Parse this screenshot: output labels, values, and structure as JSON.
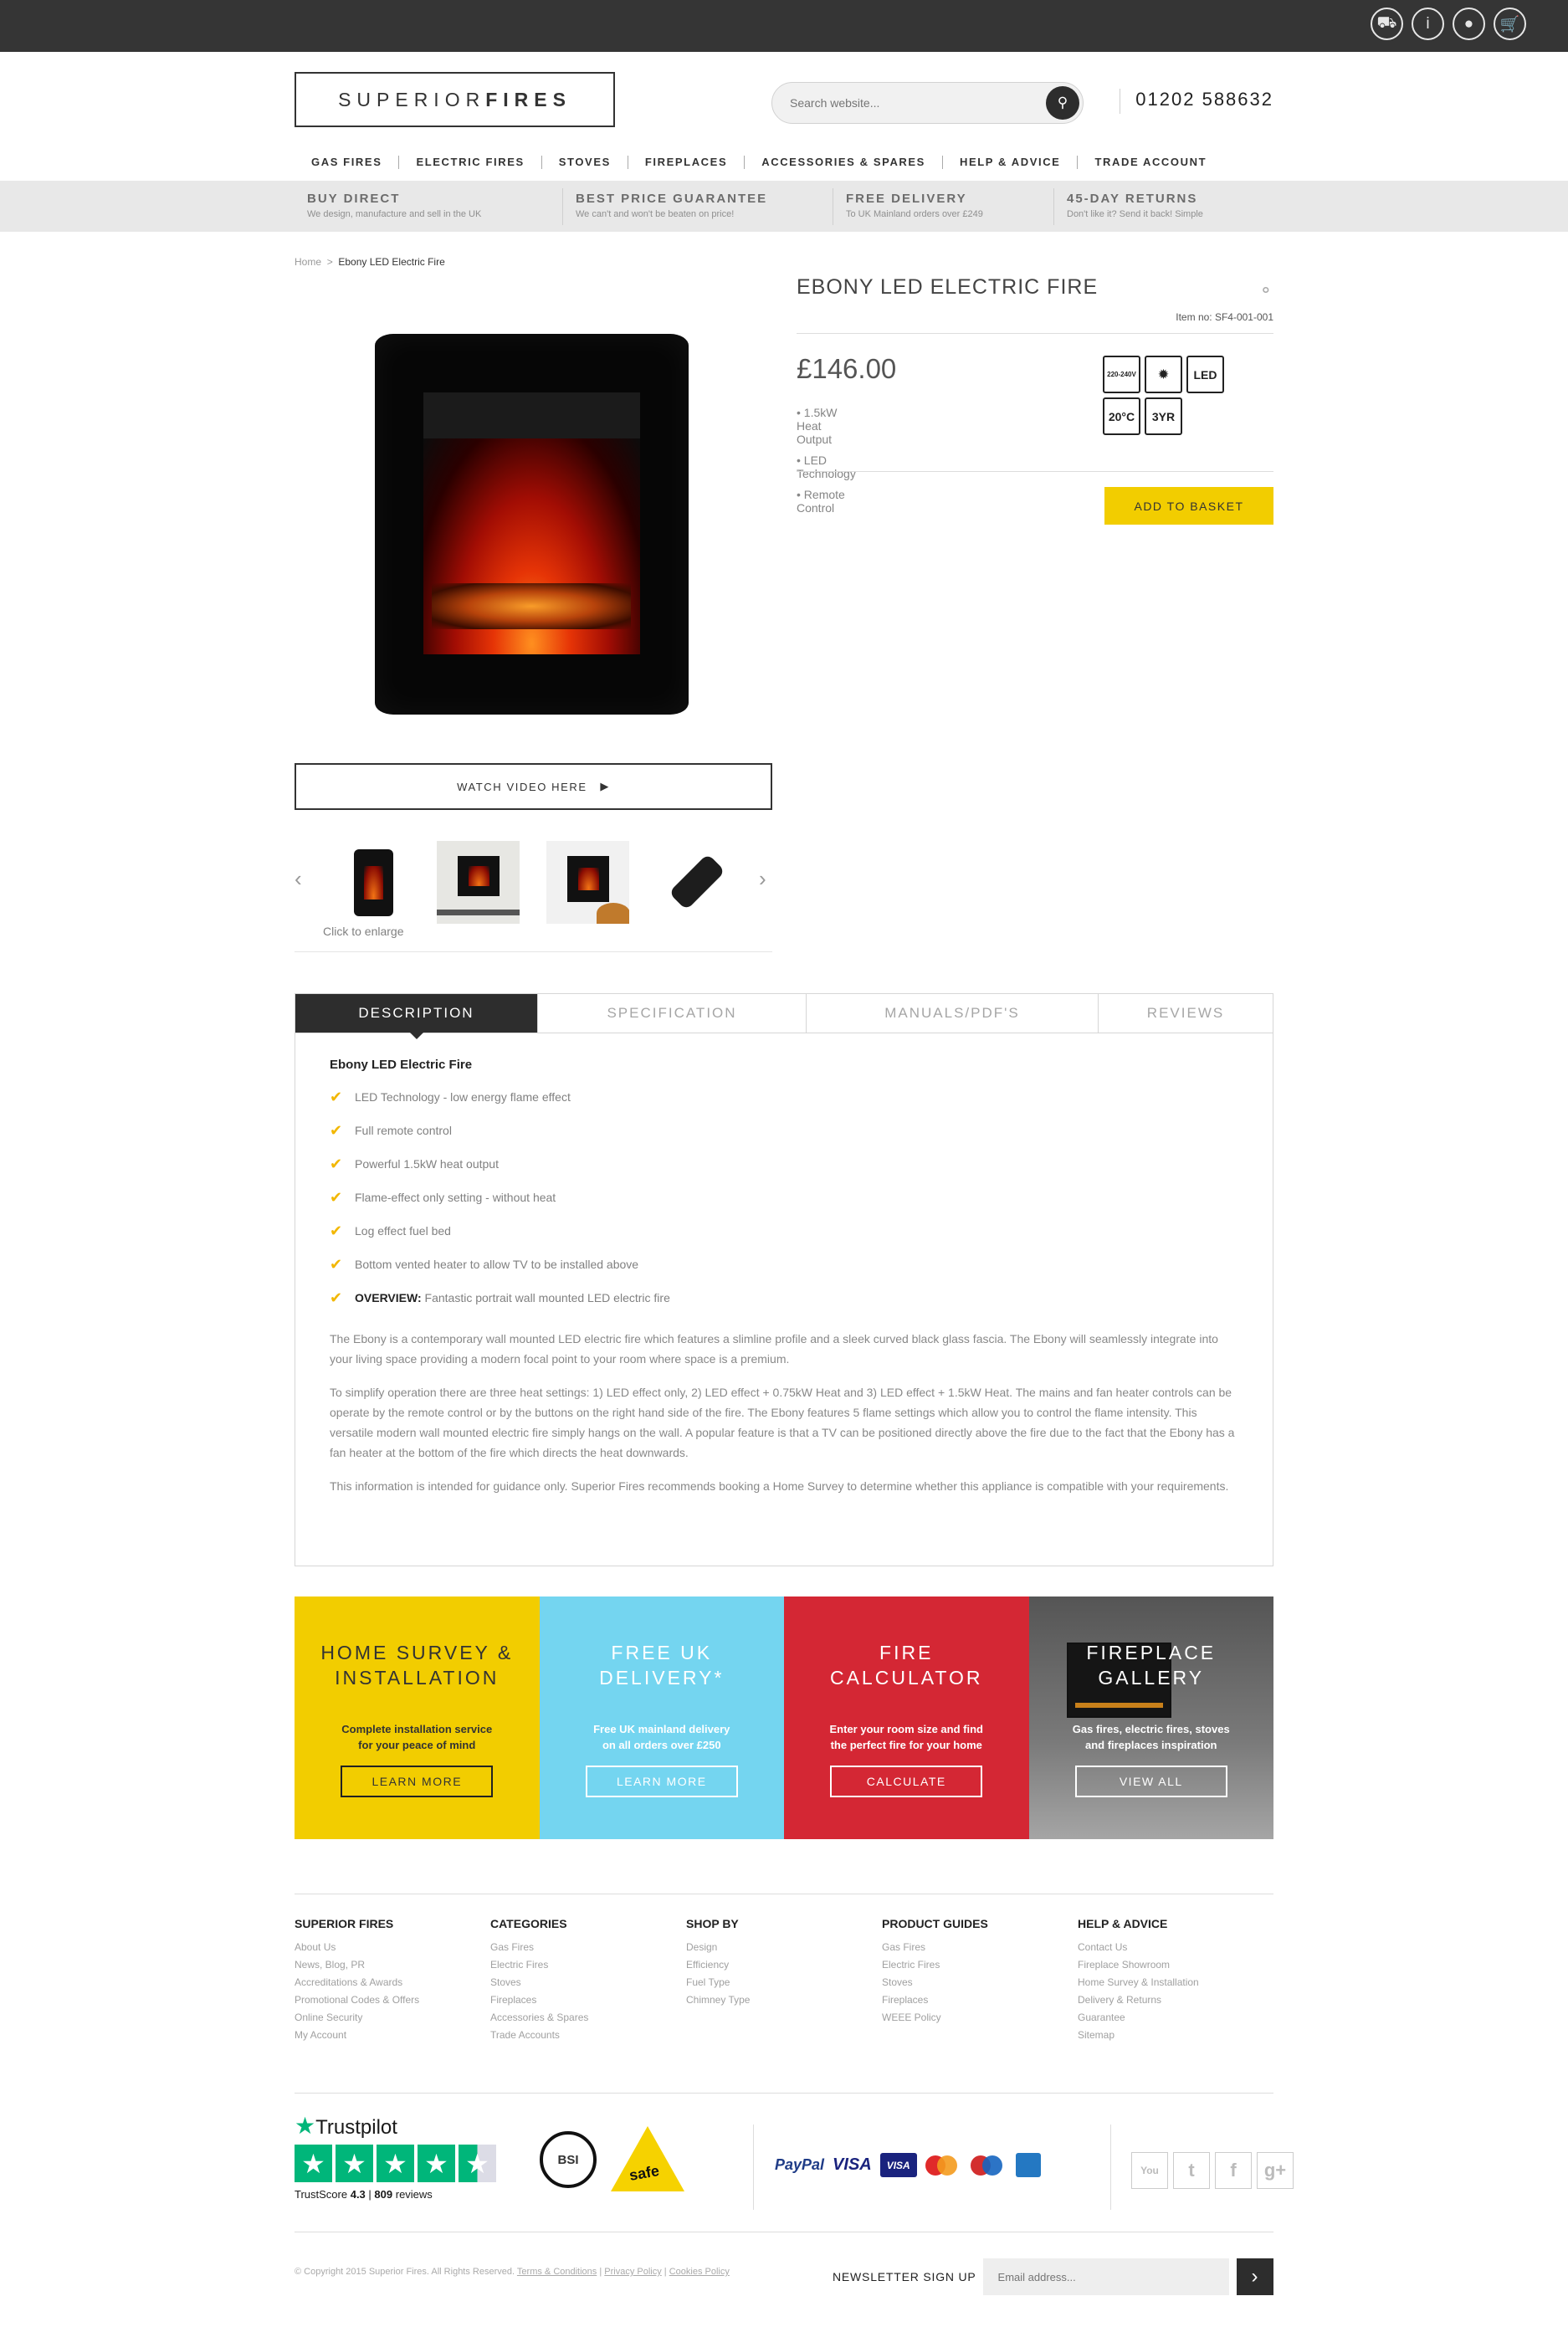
{
  "topbar": {
    "icons": [
      "delivery-truck-icon",
      "info-icon",
      "account-icon",
      "basket-icon"
    ]
  },
  "header": {
    "logo_light": "SUPERIOR",
    "logo_bold": "FIRES",
    "search_placeholder": "Search website...",
    "phone": "01202 588632"
  },
  "nav": [
    "GAS FIRES",
    "ELECTRIC FIRES",
    "STOVES",
    "FIREPLACES",
    "ACCESSORIES & SPARES",
    "HELP & ADVICE",
    "TRADE ACCOUNT"
  ],
  "usp": [
    {
      "title": "BUY DIRECT",
      "sub": "We design, manufacture and sell in the UK"
    },
    {
      "title": "BEST PRICE GUARANTEE",
      "sub": "We can't and won't be beaten on price!"
    },
    {
      "title": "FREE DELIVERY",
      "sub": "To UK Mainland orders over £249"
    },
    {
      "title": "45-DAY RETURNS",
      "sub": "Don't like it? Send it back! Simple"
    }
  ],
  "breadcrumb": {
    "home": "Home",
    "sep": ">",
    "current": "Ebony LED Electric Fire"
  },
  "product": {
    "title": "EBONY LED ELECTRIC FIRE",
    "item_no": "Item no: SF4-001-001",
    "price": "£146.00",
    "bullets": [
      "1.5kW Heat Output",
      "LED Technology",
      "Remote Control"
    ],
    "badges": [
      "220-240V",
      "Fan",
      "LED",
      "20°C",
      "3YR"
    ],
    "add_to_basket": "ADD TO BASKET",
    "watch_video": "WATCH VIDEO HERE",
    "click_to_enlarge": "Click to enlarge"
  },
  "tabs": [
    "DESCRIPTION",
    "SPECIFICATION",
    "MANUALS/PDF'S",
    "REVIEWS"
  ],
  "description": {
    "title": "Ebony LED Electric Fire",
    "features": [
      "LED Technology - low energy flame effect",
      "Full remote control",
      "Powerful 1.5kW heat output",
      "Flame-effect only setting - without heat",
      "Log effect fuel bed",
      "Bottom vented heater to allow TV to be installed above"
    ],
    "overview_label": "OVERVIEW:",
    "overview_text": " Fantastic portrait wall mounted LED electric fire",
    "paragraphs": [
      "The Ebony is a contemporary wall mounted LED electric fire which features a slimline profile and a sleek curved black glass fascia. The Ebony will seamlessly integrate into your living space providing a modern focal point to your room where space is a premium.",
      "To simplify operation there are three heat settings: 1) LED effect only, 2) LED effect + 0.75kW Heat and 3) LED effect + 1.5kW Heat. The mains and fan heater controls can be operate by the remote control or by the buttons on the right hand side of the fire. The Ebony features 5 flame settings which allow you to control the flame intensity. This versatile modern wall mounted electric fire simply hangs on the wall. A popular feature is that a TV can be positioned directly above the fire due to the fact that the Ebony has a fan heater at the bottom of the fire which directs the heat downwards.",
      "This information is intended for guidance only. Superior Fires recommends booking a Home Survey to determine whether this appliance is compatible with your requirements."
    ]
  },
  "promos": [
    {
      "title1": "HOME SURVEY &",
      "title2": "INSTALLATION",
      "sub1": "Complete installation service",
      "sub2": "for your peace of mind",
      "button": "LEARN MORE"
    },
    {
      "title1": "FREE UK",
      "title2": "DELIVERY*",
      "sub1": "Free UK mainland delivery",
      "sub2": "on all orders over £250",
      "button": "LEARN MORE"
    },
    {
      "title1": "FIRE",
      "title2": "CALCULATOR",
      "sub1": "Enter your room size and find",
      "sub2": "the perfect fire for your home",
      "button": "CALCULATE"
    },
    {
      "title1": "FIREPLACE",
      "title2": "GALLERY",
      "sub1": "Gas fires, electric fires, stoves",
      "sub2": "and fireplaces inspiration",
      "button": "VIEW ALL"
    }
  ],
  "footer": {
    "cols": [
      {
        "title": "SUPERIOR FIRES",
        "links": [
          "About Us",
          "News, Blog, PR",
          "Accreditations & Awards",
          "Promotional Codes & Offers",
          "Online Security",
          "My Account"
        ]
      },
      {
        "title": "CATEGORIES",
        "links": [
          "Gas Fires",
          "Electric Fires",
          "Stoves",
          "Fireplaces",
          "Accessories & Spares",
          "Trade Accounts"
        ]
      },
      {
        "title": "SHOP BY",
        "links": [
          "Design",
          "Efficiency",
          "Fuel Type",
          "Chimney Type"
        ]
      },
      {
        "title": "PRODUCT GUIDES",
        "links": [
          "Gas Fires",
          "Electric Fires",
          "Stoves",
          "Fireplaces",
          "WEEE Policy"
        ]
      },
      {
        "title": "HELP & ADVICE",
        "links": [
          "Contact Us",
          "Fireplace Showroom",
          "Home Survey & Installation",
          "Delivery & Returns",
          "Guarantee",
          "Sitemap"
        ]
      }
    ],
    "trustpilot": {
      "name": "Trustpilot",
      "score_label": "TrustScore",
      "score": "4.3",
      "reviews": "809",
      "reviews_label": "reviews"
    },
    "bsi": "BSI",
    "gas_safe": "safe",
    "payments": [
      "PayPal",
      "VISA",
      "VISA",
      "Maestro",
      "Maestro",
      "AMEX"
    ],
    "social": [
      "You",
      "t",
      "f",
      "g+"
    ],
    "copyright": "© Copyright 2015 Superior Fires. All Rights Reserved.",
    "legal": [
      "Terms & Conditions",
      "Privacy Policy",
      "Cookies Policy"
    ],
    "newsletter_label": "NEWSLETTER SIGN UP",
    "newsletter_placeholder": "Email address..."
  }
}
